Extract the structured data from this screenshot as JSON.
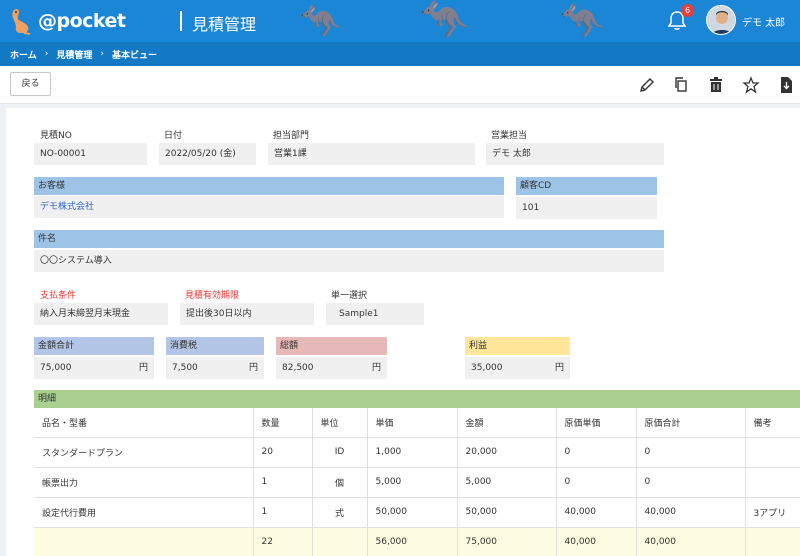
{
  "header": {
    "logo_text": "@pocket",
    "app_title": "見積管理",
    "notification_count": "6",
    "user_name": "デモ 太郎"
  },
  "breadcrumb": [
    "ホーム",
    "見積管理",
    "基本ビュー"
  ],
  "toolbar": {
    "back_label": "戻る",
    "icons": [
      "edit-icon",
      "copy-icon",
      "delete-icon",
      "star-icon",
      "download-icon"
    ]
  },
  "form": {
    "estimate_no": {
      "label": "見積NO",
      "value": "NO-00001"
    },
    "date": {
      "label": "日付",
      "value": "2022/05/20 (金)"
    },
    "department": {
      "label": "担当部門",
      "value": "営業1課"
    },
    "sales_rep": {
      "label": "営業担当",
      "value": "デモ 太郎"
    },
    "customer": {
      "label": "お客様",
      "value": "デモ株式会社"
    },
    "customer_cd": {
      "label": "顧客CD",
      "value": "101"
    },
    "subject": {
      "label": "件名",
      "value": "〇〇システム導入"
    },
    "payment_terms": {
      "label": "支払条件",
      "value": "納入月末締翌月末現金"
    },
    "validity": {
      "label": "見積有効期限",
      "value": "提出後30日以内"
    },
    "single_select": {
      "label": "単一選択",
      "value": "Sample1"
    },
    "amount_total": {
      "label": "金額合計",
      "value": "75,000",
      "unit": "円"
    },
    "tax": {
      "label": "消費税",
      "value": "7,500",
      "unit": "円"
    },
    "grand_total": {
      "label": "総額",
      "value": "82,500",
      "unit": "円"
    },
    "profit": {
      "label": "利益",
      "value": "35,000",
      "unit": "円"
    }
  },
  "details": {
    "title": "明細",
    "columns": [
      "品名・型番",
      "数量",
      "単位",
      "単価",
      "金額",
      "原価単価",
      "原価合計",
      "備考"
    ],
    "rows": [
      [
        "スタンダードプラン",
        "20",
        "ID",
        "1,000",
        "20,000",
        "0",
        "0",
        ""
      ],
      [
        "帳票出力",
        "1",
        "個",
        "5,000",
        "5,000",
        "0",
        "0",
        ""
      ],
      [
        "設定代行費用",
        "1",
        "式",
        "50,000",
        "50,000",
        "40,000",
        "40,000",
        "3アプリ"
      ]
    ],
    "total_row": [
      "",
      "22",
      "",
      "56,000",
      "75,000",
      "40,000",
      "40,000",
      ""
    ]
  },
  "colors": {
    "header_bg": "#1c86d6",
    "breadcrumb_bg": "#1479c4",
    "label_blue": "#9dc3e6",
    "label_periwinkle": "#b4c6e7",
    "label_pink": "#e6b8b7",
    "label_yellow": "#ffe699",
    "details_green": "#a9d08e",
    "required_red": "#e53935",
    "link_blue": "#2f66c0"
  }
}
